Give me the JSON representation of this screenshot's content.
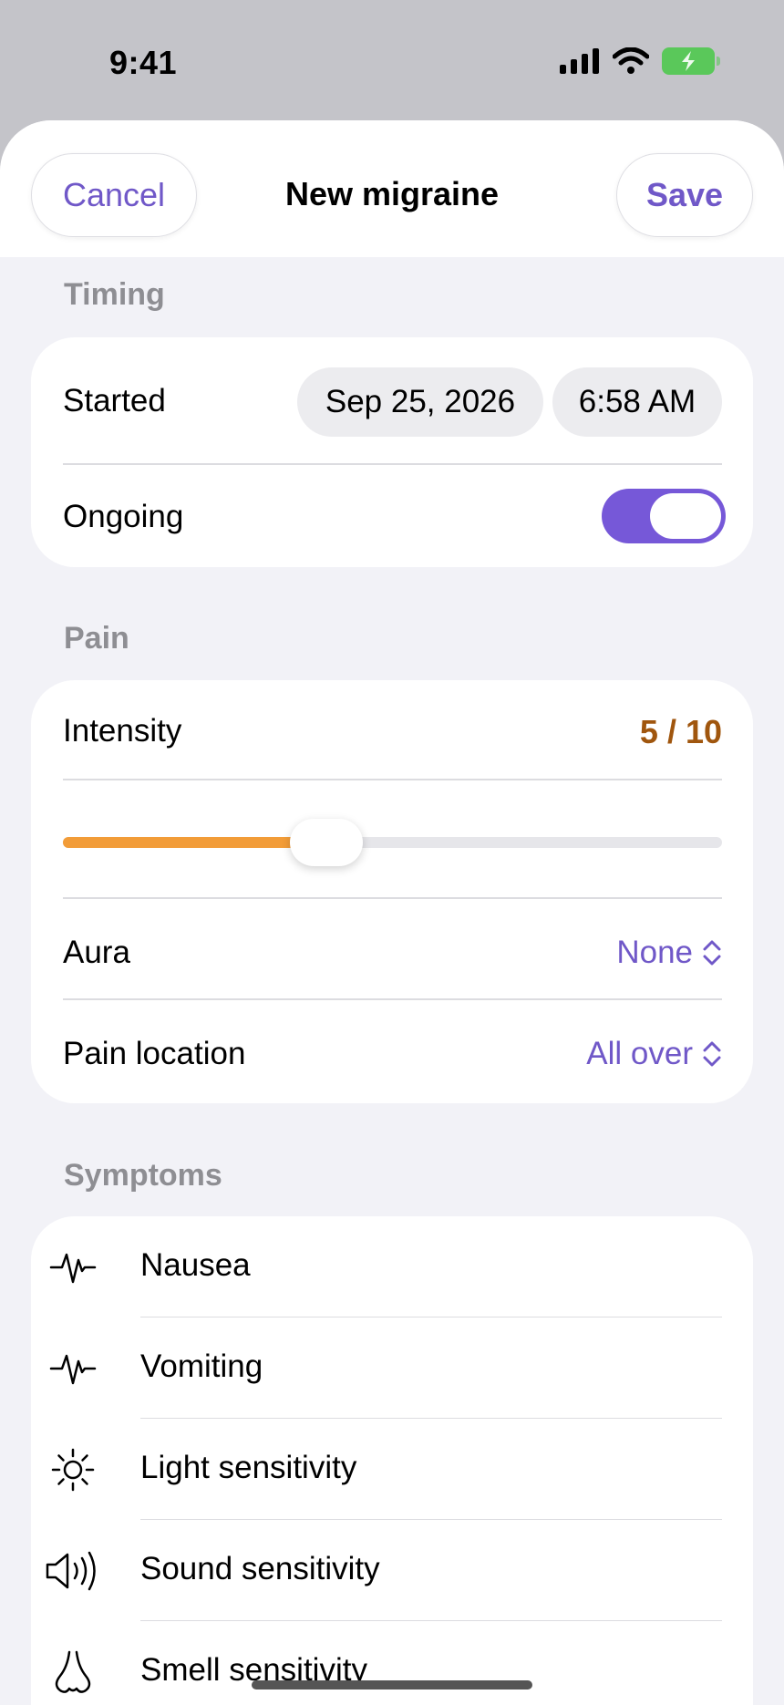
{
  "status_bar": {
    "time": "9:41"
  },
  "nav": {
    "cancel_label": "Cancel",
    "title": "New migraine",
    "save_label": "Save"
  },
  "timing": {
    "section_label": "Timing",
    "started_label": "Started",
    "date": "Sep 25, 2026",
    "time": "6:58 AM",
    "ongoing_label": "Ongoing",
    "ongoing_on": true
  },
  "pain": {
    "section_label": "Pain",
    "intensity_label": "Intensity",
    "intensity_display": "5 / 10",
    "intensity_value": 5,
    "intensity_max": 10,
    "aura_label": "Aura",
    "aura_value": "None",
    "location_label": "Pain location",
    "location_value": "All over"
  },
  "symptoms": {
    "section_label": "Symptoms",
    "items": [
      {
        "label": "Nausea",
        "icon": "waveform-icon"
      },
      {
        "label": "Vomiting",
        "icon": "waveform-icon"
      },
      {
        "label": "Light sensitivity",
        "icon": "sun-icon"
      },
      {
        "label": "Sound sensitivity",
        "icon": "speaker-icon"
      },
      {
        "label": "Smell sensitivity",
        "icon": "nose-icon"
      }
    ]
  },
  "colors": {
    "accent": "#7058c8",
    "toggle_on": "#7658d8",
    "slider_fill": "#f29c38",
    "intensity_text": "#a0560e"
  }
}
